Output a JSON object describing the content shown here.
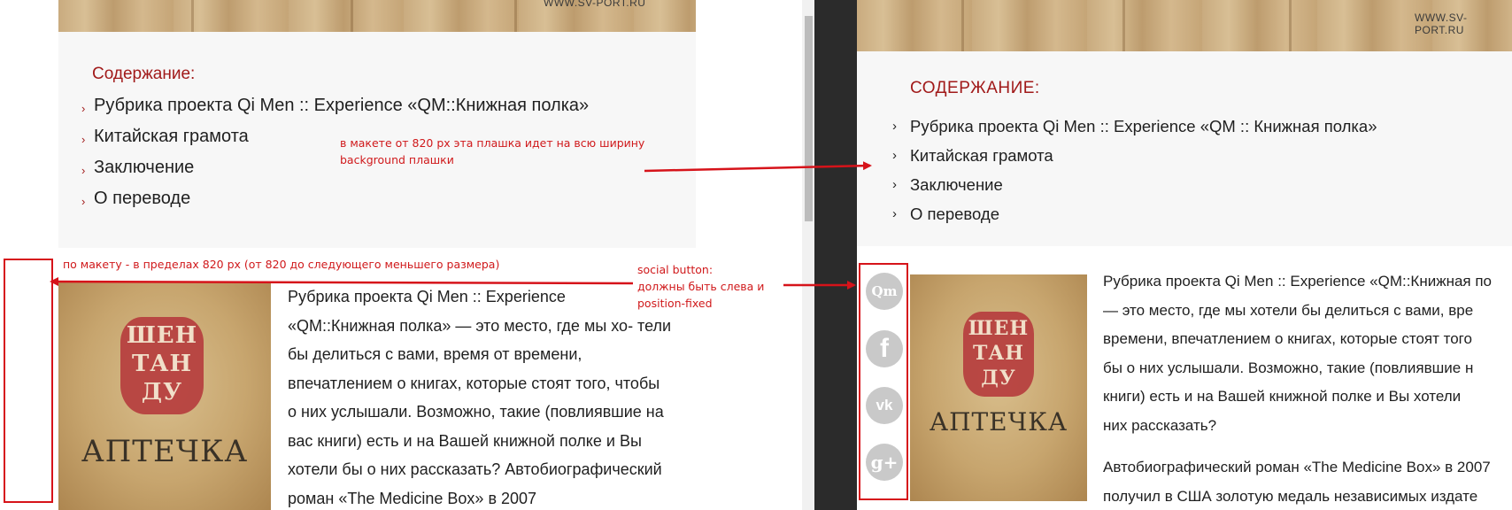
{
  "left": {
    "banner_url": "WWW.SV-PORT.RU",
    "toc_title": "Содержание:",
    "toc_items": [
      "Рубрика проекта Qi Men :: Experience «QM::Книжная полка»",
      "Китайская грамота",
      "Заключение",
      "О переводе"
    ],
    "article_lines": [
      "Рубрика проекта Qi Men :: Experience",
      "«QM::Книжная полка» — это место, где мы хо- тели",
      "бы делиться с вами, время от времени,",
      "впечатлением о книгах, которые стоят того, чтобы",
      "о них услышали. Возможно, такие (повлиявшие на",
      "вас книги) есть и на Вашей книжной полке и Вы",
      "хотели бы о них рассказать? Автобиографический",
      "роман «The Medicine Box» в 2007"
    ]
  },
  "cover": {
    "seal_lines": [
      "ШЕН",
      "ТАН",
      "ДУ"
    ],
    "title": "АПТЕЧКА"
  },
  "annotations": {
    "toc_note": [
      "в макете от 820 px эта плашка идет на всю ширину",
      "background плашки"
    ],
    "width_note": "по макету - в пределах 820 px (от 820 до следующего меньшего размера)",
    "social_note": [
      "social button:",
      "должны быть слева и",
      "position-fixed"
    ]
  },
  "right": {
    "banner_url": "WWW.SV-PORT.RU",
    "toc_title": "СОДЕРЖАНИЕ:",
    "toc_items": [
      "Рубрика проекта Qi Men :: Experience «QM :: Книжная полка»",
      "Китайская грамота",
      "Заключение",
      "О переводе"
    ],
    "social_buttons": [
      {
        "icon": "qm-icon",
        "glyph": "Qm"
      },
      {
        "icon": "facebook-icon",
        "glyph": "f"
      },
      {
        "icon": "vk-icon",
        "glyph": "vk"
      },
      {
        "icon": "google-plus-icon",
        "glyph": "g+"
      }
    ],
    "article_lines": [
      "Рубрика проекта Qi Men :: Experience «QM::Книжная по",
      "— это место, где мы хотели бы делиться с вами, вре",
      "времени, впечатлением о книгах, которые стоят того",
      "бы о них услышали. Возможно, такие (повлиявшие н",
      "книги) есть и на Вашей книжной полке и Вы хотели",
      "них рассказать?"
    ],
    "article2_lines": [
      "Автобиографический роман «The Medicine Box» в 2007",
      "получил в США золотую медаль независимых издате"
    ]
  },
  "colors": {
    "accent": "#a11a1a",
    "annotation": "#d6131a",
    "toc_background": "#f7f7f7",
    "divider": "#2b2b2b"
  }
}
